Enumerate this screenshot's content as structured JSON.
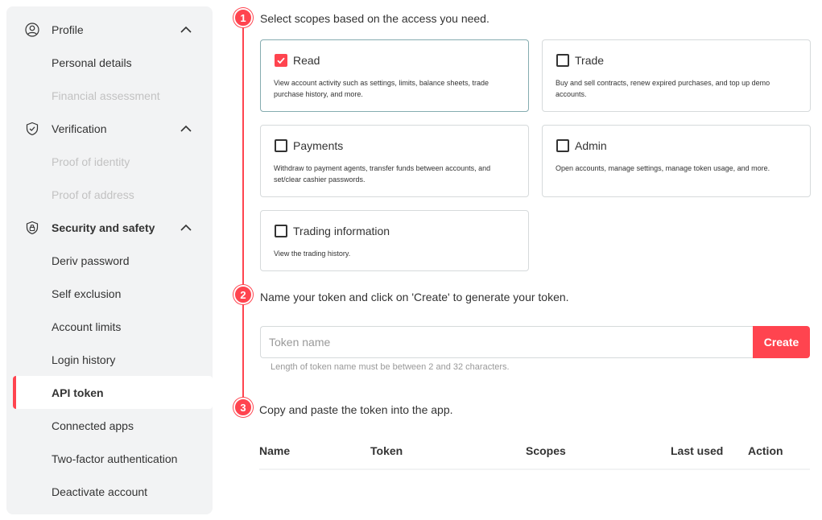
{
  "sidebar": {
    "profile": {
      "label": "Profile",
      "icon": "user-circle-icon",
      "items": [
        {
          "label": "Personal details",
          "disabled": false
        },
        {
          "label": "Financial assessment",
          "disabled": true
        }
      ]
    },
    "verification": {
      "label": "Verification",
      "icon": "shield-check-icon",
      "items": [
        {
          "label": "Proof of identity",
          "disabled": true
        },
        {
          "label": "Proof of address",
          "disabled": true
        }
      ]
    },
    "security": {
      "label": "Security and safety",
      "icon": "shield-lock-icon",
      "items": [
        {
          "label": "Deriv password"
        },
        {
          "label": "Self exclusion"
        },
        {
          "label": "Account limits"
        },
        {
          "label": "Login history"
        },
        {
          "label": "API token",
          "active": true
        },
        {
          "label": "Connected apps"
        },
        {
          "label": "Two-factor authentication"
        },
        {
          "label": "Deactivate account"
        }
      ]
    }
  },
  "steps": [
    {
      "number": "1",
      "text": "Select scopes based on the access you need."
    },
    {
      "number": "2",
      "text": "Name your token and click on 'Create' to generate your token."
    },
    {
      "number": "3",
      "text": "Copy and paste the token into the app."
    }
  ],
  "scopes": [
    {
      "title": "Read",
      "checked": true,
      "description": "View account activity such as settings, limits, balance sheets, trade purchase history, and more."
    },
    {
      "title": "Trade",
      "checked": false,
      "description": "Buy and sell contracts, renew expired purchases, and top up demo accounts."
    },
    {
      "title": "Payments",
      "checked": false,
      "description": "Withdraw to payment agents, transfer funds between accounts, and set/clear cashier passwords."
    },
    {
      "title": "Admin",
      "checked": false,
      "description": "Open accounts, manage settings, manage token usage, and more."
    },
    {
      "title": "Trading information",
      "checked": false,
      "description": "View the trading history."
    }
  ],
  "token_form": {
    "placeholder": "Token name",
    "value": "",
    "create_label": "Create",
    "hint": "Length of token name must be between 2 and 32 characters."
  },
  "table": {
    "headers": [
      "Name",
      "Token",
      "Scopes",
      "Last used",
      "Action"
    ]
  },
  "colors": {
    "accent": "#ff444f",
    "sidebar_bg": "#f2f3f4",
    "disabled_text": "#c2c2c2",
    "selected_border": "#85acb0"
  }
}
